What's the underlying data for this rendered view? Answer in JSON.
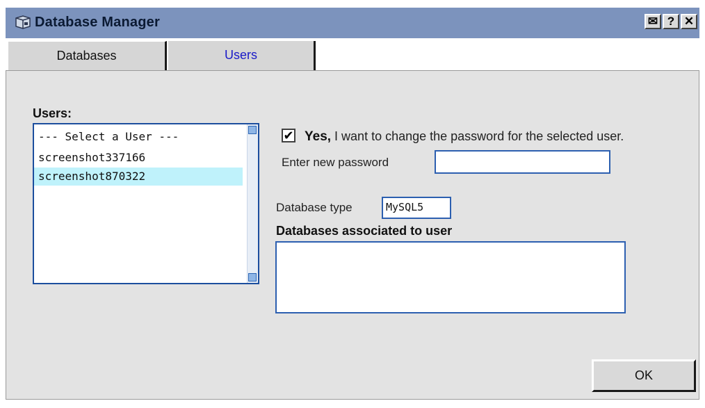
{
  "window": {
    "title": "Database Manager",
    "controls": [
      "✉",
      "?",
      "✕"
    ]
  },
  "tabs": [
    {
      "label": "Databases",
      "active": false
    },
    {
      "label": "Users",
      "active": true
    }
  ],
  "users": {
    "label": "Users:",
    "items": [
      "--- Select a User ---",
      "screenshot337166",
      "screenshot870322"
    ],
    "selected_index": 2
  },
  "password": {
    "checked": true,
    "check_bold": "Yes,",
    "check_text": " I want to change the password for the selected user.",
    "new_password_label": "Enter new password",
    "new_password_value": ""
  },
  "database": {
    "type_label": "Database type",
    "type_value": "MySQL5",
    "associated_label": "Databases associated to user",
    "associated_value": ""
  },
  "actions": {
    "ok_label": "OK"
  },
  "colors": {
    "titlebar": "#7c93bd",
    "active_tab_text": "#1a1ac8",
    "selected_row": "#bff2fb",
    "field_border": "#2c5fb0"
  }
}
